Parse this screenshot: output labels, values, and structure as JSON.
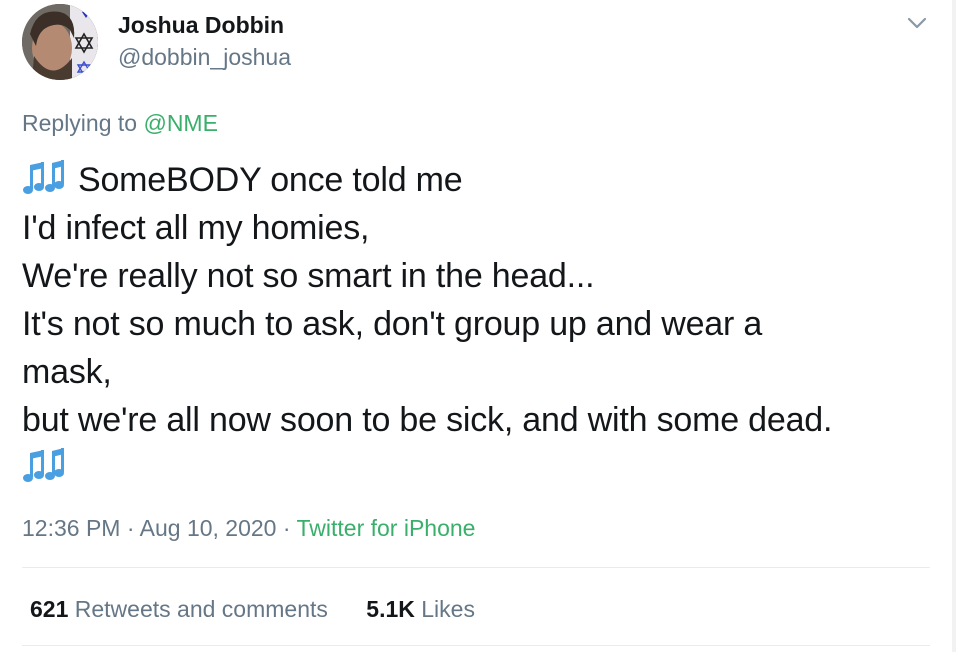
{
  "author": {
    "display_name": "Joshua Dobbin",
    "handle": "@dobbin_joshua",
    "avatar_icon": "profile-photo"
  },
  "reply": {
    "prefix": "Replying to ",
    "mention": "@NME"
  },
  "tweet": {
    "lines": [
      "SomeBODY once told me",
      "I'd infect all my homies,",
      "We're really not so smart in the head...",
      "It's not so much to ask, don't group up and wear a",
      "mask,",
      "but we're all now soon to be sick, and with some dead."
    ],
    "emoji": "musical-notes-icon"
  },
  "meta": {
    "time": "12:36 PM",
    "separator": " · ",
    "date": "Aug 10, 2020",
    "source": "Twitter for iPhone"
  },
  "stats": {
    "retweets_count": "621",
    "retweets_label": "Retweets and comments",
    "likes_count": "5.1K",
    "likes_label": "Likes"
  },
  "colors": {
    "text": "#14171a",
    "secondary": "#657786",
    "link": "#3aaf6b",
    "emoji_blue": "#4a9fe0",
    "divider": "#e6ecf0"
  }
}
